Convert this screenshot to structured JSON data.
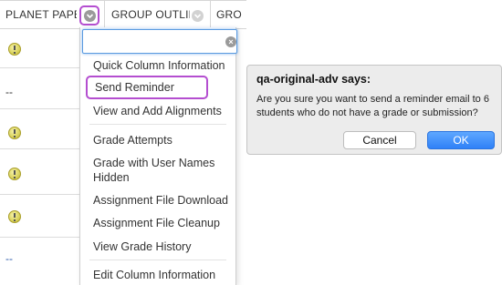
{
  "grid": {
    "columns": [
      {
        "label": "PLANET PAPER"
      },
      {
        "label": "GROUP OUTLIN"
      },
      {
        "label": "GRO"
      }
    ],
    "rows": [
      {
        "value": ""
      },
      {
        "value": "--"
      },
      {
        "value": ""
      },
      {
        "value": ""
      },
      {
        "value": ""
      },
      {
        "value": "--"
      }
    ]
  },
  "menu": {
    "search_value": "",
    "clear_glyph": "×",
    "items": [
      {
        "label": "Quick Column Information"
      },
      {
        "label": "Send Reminder"
      },
      {
        "label": "View and Add Alignments"
      },
      {
        "label": "Grade Attempts"
      },
      {
        "label": "Grade with User Names Hidden"
      },
      {
        "label": "Assignment File Download"
      },
      {
        "label": "Assignment File Cleanup"
      },
      {
        "label": "View Grade History"
      },
      {
        "label": "Edit Column Information"
      }
    ]
  },
  "dialog": {
    "title": "qa-original-adv says:",
    "message": "Are you sure you want to send a reminder email to 6 students who do not have a grade or submission?",
    "cancel_label": "Cancel",
    "ok_label": "OK",
    "ok_color": "#2f81f7",
    "highlight_color": "#b44ed0"
  }
}
